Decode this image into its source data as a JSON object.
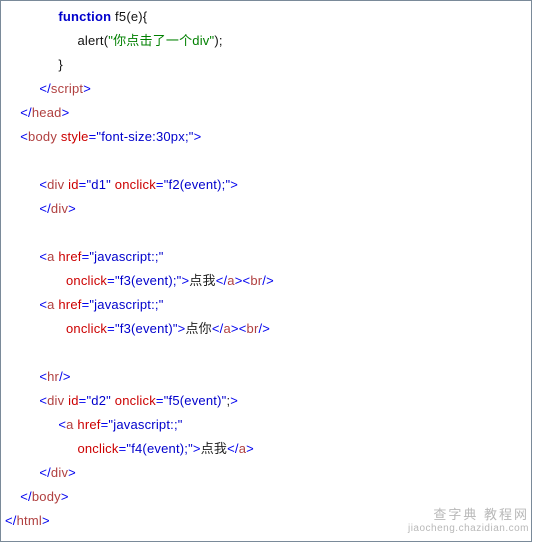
{
  "lines": {
    "l1_fn_kw": "function",
    "l1_fn_name": " f5",
    "l1_fn_sig": "(e){",
    "l2_call": "alert(",
    "l2_str": "\"你点击了一个div\"",
    "l2_end": ");",
    "l3_brace": "}",
    "l4_tag": "script",
    "l5_tag": "head",
    "l6_tag": "body",
    "l6_attr": "style",
    "l6_val": "\"font-size:30px;\"",
    "l7_tag": "div",
    "l7_attr1": "id",
    "l7_val1": "\"d1\"",
    "l7_attr2": "onclick",
    "l7_val2": "\"f2(event);\"",
    "l8_tag": "div",
    "l9_tag": "a",
    "l9_attr": "href",
    "l9_val": "\"javascript:;\"",
    "l10_attr": "onclick",
    "l10_val": "\"f3(event);\"",
    "l10_txt": "点我",
    "l10_close_a": "a",
    "l10_br": "br",
    "l11_tag": "a",
    "l11_attr": "href",
    "l11_val": "\"javascript:;\"",
    "l12_attr": "onclick",
    "l12_val": "\"f3(event)\"",
    "l12_txt": "点你",
    "l12_close_a": "a",
    "l12_br": "br",
    "l13_tag": "hr",
    "l14_tag": "div",
    "l14_attr1": "id",
    "l14_val1": "\"d2\"",
    "l14_attr2": "onclick",
    "l14_val2": "\"f5(event)\"",
    "l15_tag": "a",
    "l15_attr": "href",
    "l15_val": "\"javascript:;\"",
    "l16_attr": "onclick",
    "l16_val": "\"f4(event);\"",
    "l16_txt": "点我",
    "l16_close_a": "a",
    "l17_tag": "div",
    "l18_tag": "body",
    "l19_tag": "html"
  },
  "watermark": {
    "cn": "查字典 教程网",
    "en": "jiaocheng.chazidian.com"
  }
}
